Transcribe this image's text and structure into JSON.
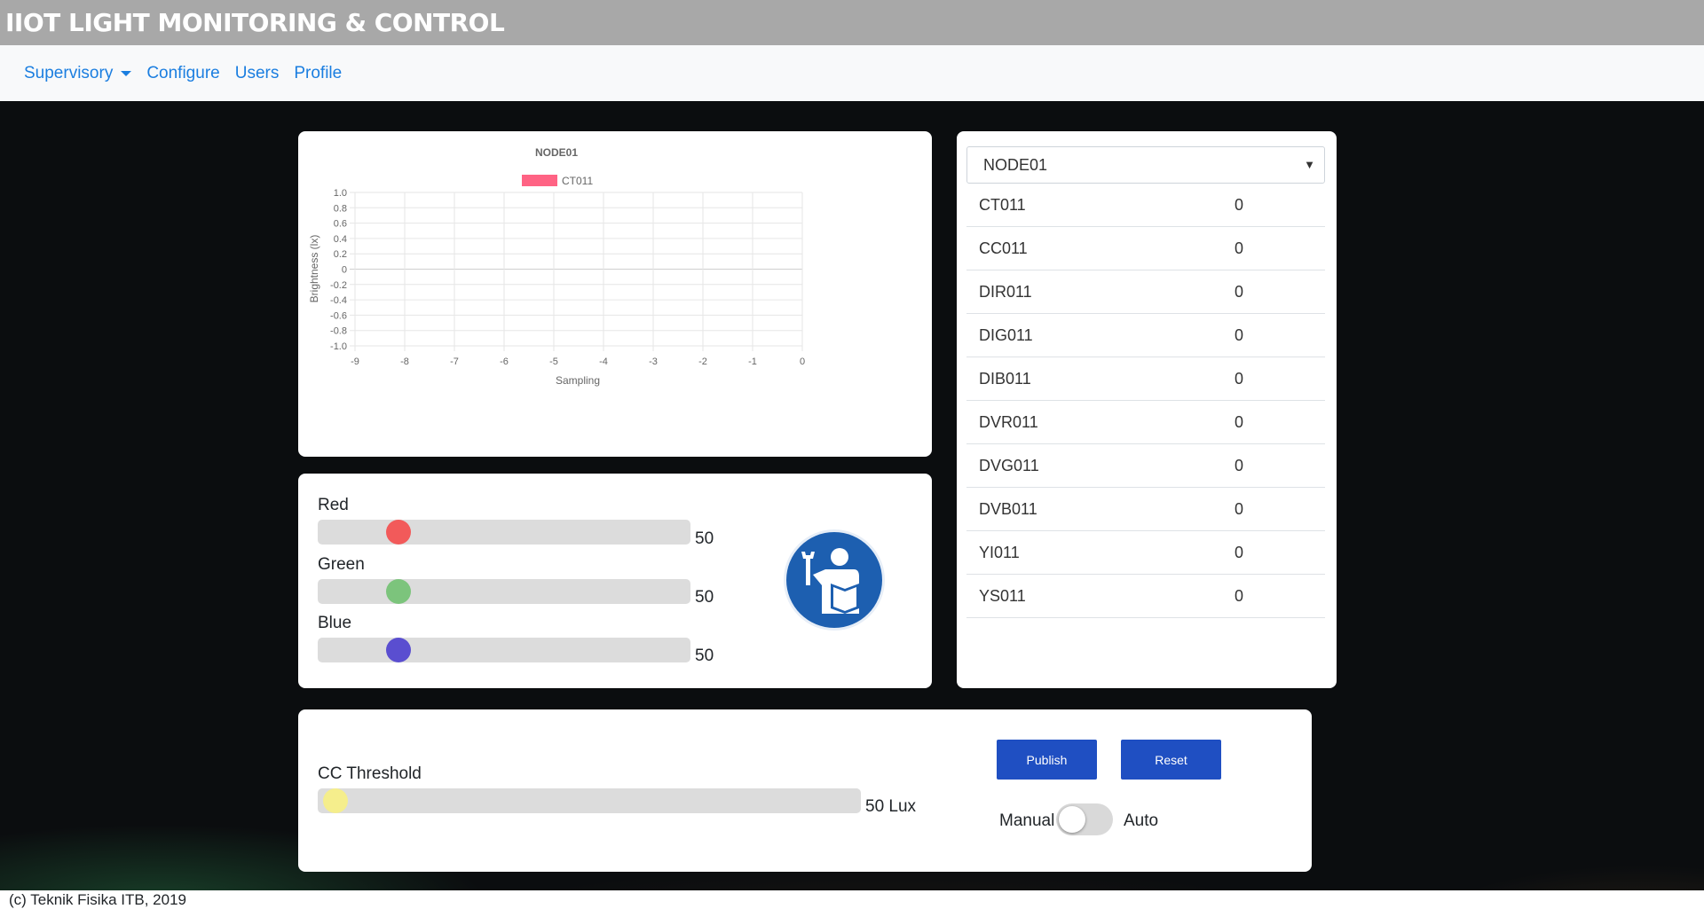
{
  "app": {
    "title": "IIOT LIGHT MONITORING & CONTROL"
  },
  "nav": {
    "supervisory": "Supervisory",
    "configure": "Configure",
    "users": "Users",
    "profile": "Profile"
  },
  "chart_data": {
    "type": "line",
    "title": "NODE01",
    "series": [
      {
        "name": "CT011",
        "color": "#ff6384",
        "values": []
      }
    ],
    "xlabel": "Sampling",
    "ylabel": "Brightness (lx)",
    "x_ticks": [
      "-9",
      "-8",
      "-7",
      "-6",
      "-5",
      "-4",
      "-3",
      "-2",
      "-1",
      "0"
    ],
    "y_ticks": [
      "1.0",
      "0.8",
      "0.6",
      "0.4",
      "0.2",
      "0",
      "-0.2",
      "-0.4",
      "-0.6",
      "-0.8",
      "-1.0"
    ],
    "xlim": [
      -9,
      0
    ],
    "ylim": [
      -1,
      1
    ],
    "grid": true,
    "legend": "top-center"
  },
  "sliders": {
    "red": {
      "label": "Red",
      "value": "50",
      "level": 50,
      "color": "#f25a5a"
    },
    "green": {
      "label": "Green",
      "value": "50",
      "level": 50,
      "color": "#7cc47c"
    },
    "blue": {
      "label": "Blue",
      "value": "50",
      "level": 50,
      "color": "#5a4ed0"
    }
  },
  "node_select": {
    "selected": "NODE01"
  },
  "table": {
    "rows": [
      {
        "name": "CT011",
        "value": "0"
      },
      {
        "name": "CC011",
        "value": "0"
      },
      {
        "name": "DIR011",
        "value": "0"
      },
      {
        "name": "DIG011",
        "value": "0"
      },
      {
        "name": "DIB011",
        "value": "0"
      },
      {
        "name": "DVR011",
        "value": "0"
      },
      {
        "name": "DVG011",
        "value": "0"
      },
      {
        "name": "DVB011",
        "value": "0"
      },
      {
        "name": "YI011",
        "value": "0"
      },
      {
        "name": "YS011",
        "value": "0"
      }
    ]
  },
  "threshold": {
    "label": "CC Threshold",
    "value": "50 Lux",
    "level": 0,
    "color": "#f5ee8c"
  },
  "actions": {
    "publish": "Publish",
    "reset": "Reset"
  },
  "mode": {
    "manual": "Manual",
    "auto": "Auto",
    "state": "Manual"
  },
  "footer": {
    "text": "(c) Teknik Fisika ITB, 2019"
  },
  "icons": {
    "mechanic": "mechanic-icon",
    "caret": "chevron-down-icon"
  }
}
